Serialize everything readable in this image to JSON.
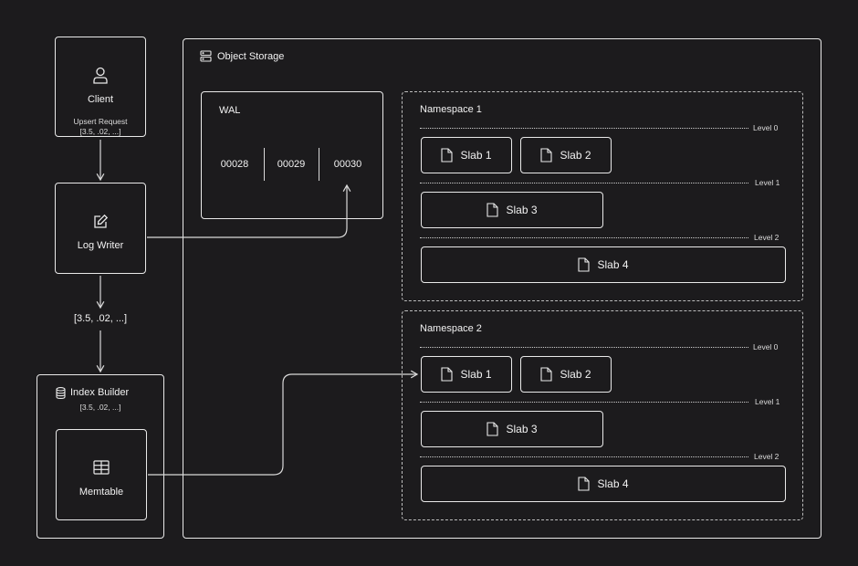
{
  "object_storage": {
    "title": "Object Storage"
  },
  "client": {
    "label": "Client",
    "request_line1": "Upsert Request",
    "request_line2": "[3.5, .02, ...]"
  },
  "log_writer": {
    "label": "Log Writer"
  },
  "vector_label": "[3.5, .02, ...]",
  "index_builder": {
    "label": "Index Builder",
    "sub": "[3.5, .02, ...]"
  },
  "memtable": {
    "label": "Memtable"
  },
  "wal": {
    "title": "WAL",
    "segments": [
      "00028",
      "00029",
      "00030"
    ]
  },
  "namespaces": [
    {
      "title": "Namespace 1",
      "levels": [
        "Level 0",
        "Level 1",
        "Level 2"
      ],
      "slabs": [
        "Slab 1",
        "Slab 2",
        "Slab 3",
        "Slab 4"
      ]
    },
    {
      "title": "Namespace 2",
      "levels": [
        "Level 0",
        "Level 1",
        "Level 2"
      ],
      "slabs": [
        "Slab 1",
        "Slab 2",
        "Slab 3",
        "Slab 4"
      ]
    }
  ],
  "colors": {
    "background": "#1c1b1d",
    "stroke": "#e9e9e9",
    "text": "#f2f2f2"
  },
  "icons": {
    "client": "user-icon",
    "log_writer": "edit-icon",
    "index_builder": "database-icon",
    "memtable": "table-icon",
    "object_storage": "server-icon",
    "slab": "file-icon"
  }
}
